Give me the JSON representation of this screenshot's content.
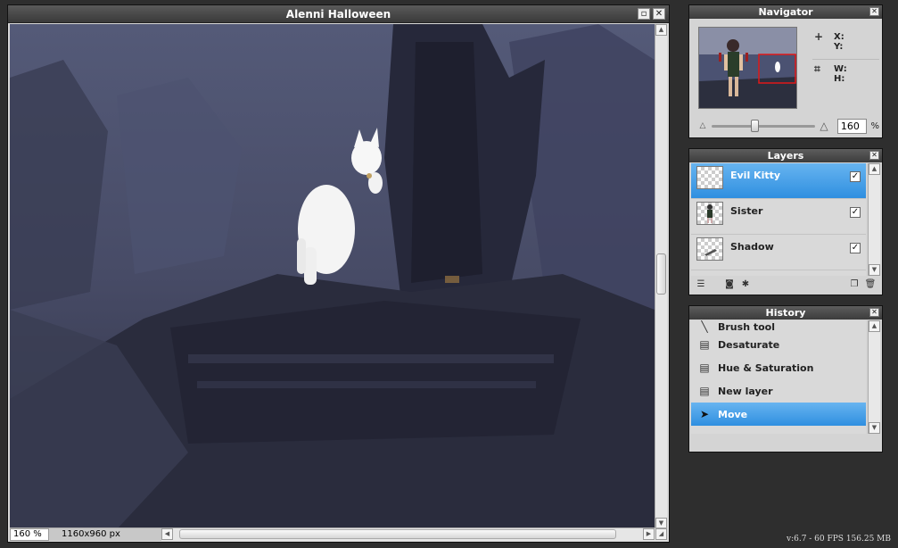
{
  "document": {
    "title": "Alenni Halloween",
    "zoom": "160 %",
    "dimensions": "1160x960 px"
  },
  "navigator": {
    "title": "Navigator",
    "x_label": "X:",
    "y_label": "Y:",
    "w_label": "W:",
    "h_label": "H:",
    "zoom_value": "160",
    "zoom_unit": "%"
  },
  "layers": {
    "title": "Layers",
    "items": [
      {
        "name": "Evil Kitty",
        "visible": true,
        "selected": true
      },
      {
        "name": "Sister",
        "visible": true,
        "selected": false
      },
      {
        "name": "Shadow",
        "visible": true,
        "selected": false
      }
    ]
  },
  "history": {
    "title": "History",
    "items": [
      {
        "label": "Brush tool",
        "icon": "brush-icon"
      },
      {
        "label": "Desaturate",
        "icon": "step-icon"
      },
      {
        "label": "Hue & Saturation",
        "icon": "step-icon"
      },
      {
        "label": "New layer",
        "icon": "step-icon"
      },
      {
        "label": "Move",
        "icon": "move-icon",
        "selected": true
      }
    ]
  },
  "status_info": "v:6.7 - 60 FPS 156.25 MB",
  "colors": {
    "selection": "#3b96e6",
    "panel_bg": "#d4d4d4",
    "title_bar": "#444444"
  }
}
